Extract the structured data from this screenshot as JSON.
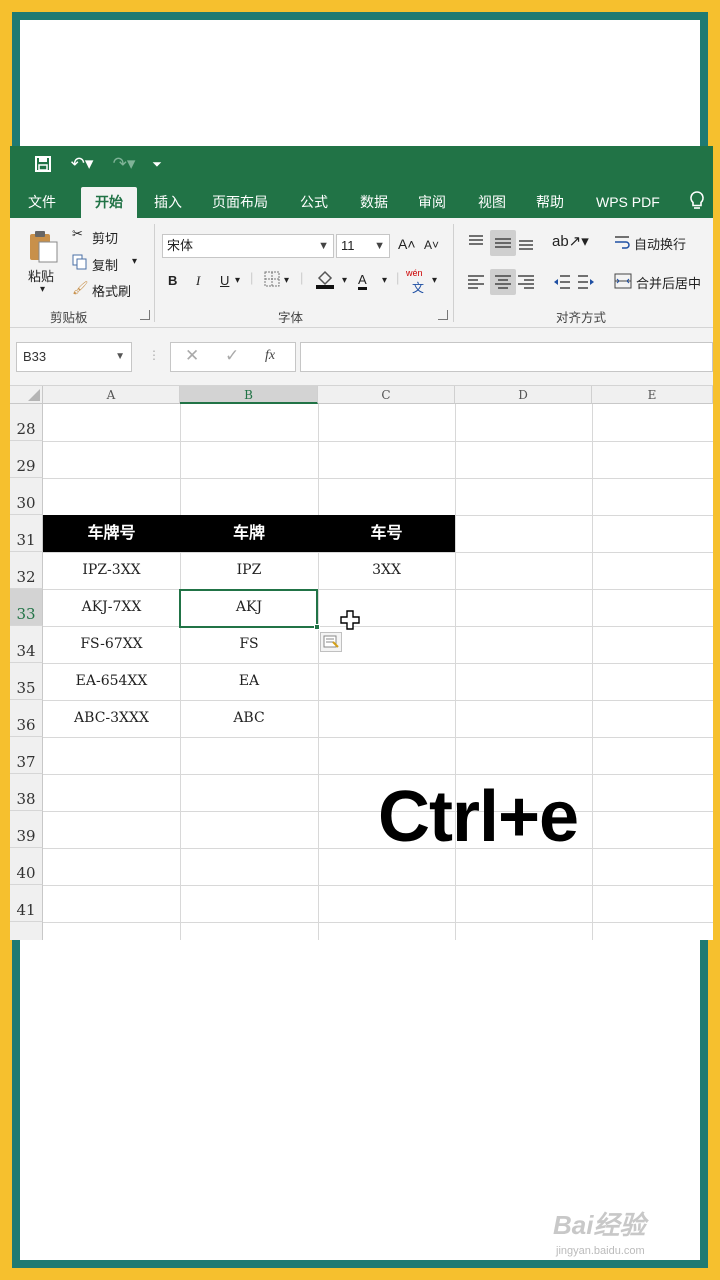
{
  "qat": {
    "save": "save-icon",
    "undo": "undo-icon",
    "redo": "redo-icon",
    "customize": "customize-icon"
  },
  "tabs": [
    "文件",
    "开始",
    "插入",
    "页面布局",
    "公式",
    "数据",
    "审阅",
    "视图",
    "帮助",
    "WPS PDF"
  ],
  "active_tab": "开始",
  "ribbon": {
    "clipboard": {
      "paste": "粘贴",
      "cut": "剪切",
      "copy": "复制",
      "format_painter": "格式刷",
      "group": "剪贴板"
    },
    "font": {
      "name": "宋体",
      "size": "11",
      "bold": "B",
      "italic": "I",
      "underline": "U",
      "font_color_letter": "A",
      "phonetic": "wén",
      "phonetic_sub": "文",
      "group": "字体"
    },
    "alignment": {
      "wrap": "自动换行",
      "merge": "合并后居中",
      "group": "对齐方式"
    }
  },
  "formula_bar": {
    "name_box": "B33",
    "fx": "fx",
    "value": ""
  },
  "columns": [
    "A",
    "B",
    "C",
    "D",
    "E"
  ],
  "selected_column": "B",
  "rows": [
    "28",
    "29",
    "30",
    "31",
    "32",
    "33",
    "34",
    "35",
    "36",
    "37",
    "38",
    "39",
    "40",
    "41"
  ],
  "selected_row": "33",
  "table": {
    "headers": [
      "车牌号",
      "车牌",
      "车号"
    ],
    "rows": [
      [
        "IPZ-3XX",
        "IPZ",
        "3XX"
      ],
      [
        "AKJ-7XX",
        "AKJ",
        ""
      ],
      [
        "FS-67XX",
        "FS",
        ""
      ],
      [
        "EA-654XX",
        "EA",
        ""
      ],
      [
        "ABC-3XXX",
        "ABC",
        ""
      ]
    ]
  },
  "overlay_text": "Ctrl+e",
  "watermark": {
    "main": "Bai经验",
    "sub": "jingyan.baidu.com"
  },
  "colors": {
    "excel_green": "#217346",
    "frame_yellow": "#f6c02e",
    "frame_teal": "#1f7a72"
  }
}
